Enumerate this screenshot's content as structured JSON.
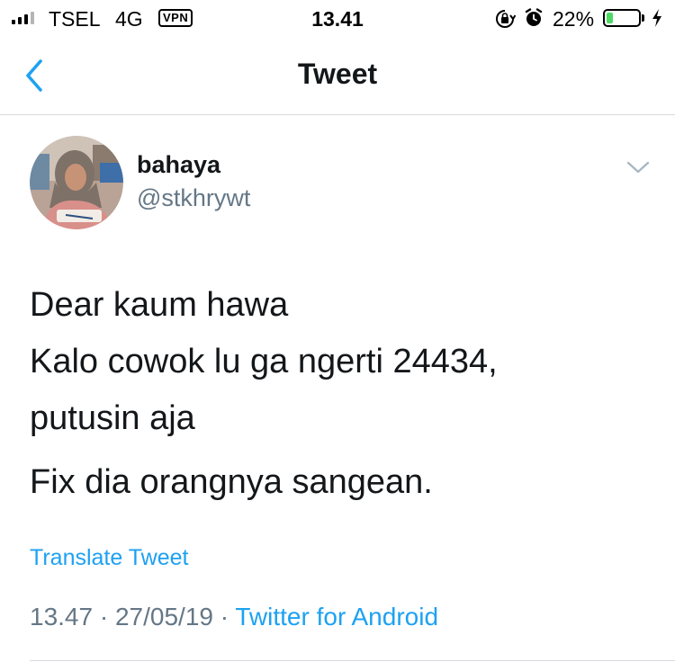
{
  "status_bar": {
    "carrier": "TSEL",
    "network": "4G",
    "vpn": "VPN",
    "time": "13.41",
    "battery_percent": "22%",
    "battery_level": 0.22,
    "signal_bars": 4,
    "signal_bars_filled": 3
  },
  "nav": {
    "title": "Tweet",
    "back_icon": "chevron-left-icon"
  },
  "tweet": {
    "display_name": "bahaya",
    "handle": "@stkhrywt",
    "text": {
      "p1_line1": "Dear kaum hawa",
      "p1_line2": "Kalo cowok lu ga ngerti 24434,",
      "p1_line3": "putusin aja",
      "p2_line1": "Fix dia orangnya sangean."
    },
    "translate_label": "Translate Tweet",
    "time": "13.47",
    "date": "27/05/19",
    "separator": " · ",
    "source": "Twitter for Android"
  },
  "colors": {
    "accent": "#1da1f2",
    "text_primary": "#14171a",
    "text_secondary": "#657786",
    "battery_fill": "#4cd964",
    "divider": "#d7dbdf"
  }
}
